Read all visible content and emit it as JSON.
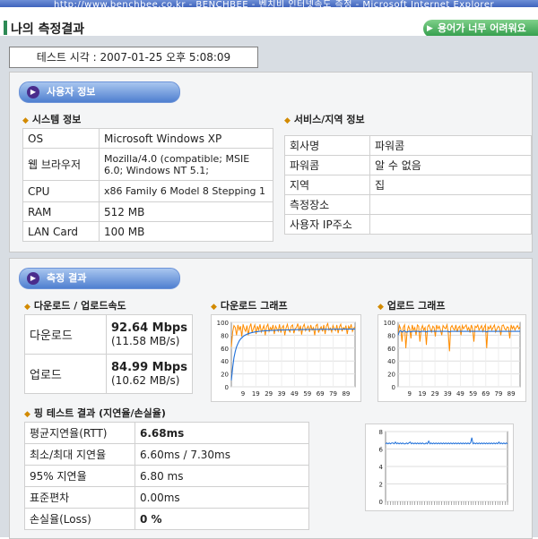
{
  "window": {
    "title": "http://www.benchbee.co.kr - BENCHBEE - 벤치비 인터넷속도 측정 - Microsoft Internet Explorer"
  },
  "header": {
    "title": "나의 측정결과",
    "help_button": "용어가 너무 어려워요"
  },
  "test_time": "테스트 시각 : 2007-01-25 오후 5:08:09",
  "user_info": {
    "title": "사용자 정보",
    "system": {
      "title": "시스템 정보",
      "rows": [
        {
          "label": "OS",
          "value": "Microsoft Windows XP"
        },
        {
          "label": "웹 브라우저",
          "value": "Mozilla/4.0 (compatible; MSIE 6.0; Windows NT 5.1;"
        },
        {
          "label": "CPU",
          "value": "x86 Family 6 Model 8 Stepping 1"
        },
        {
          "label": "RAM",
          "value": "512 MB"
        },
        {
          "label": "LAN Card",
          "value": "100 MB"
        }
      ]
    },
    "service": {
      "title": "서비스/지역 정보",
      "rows": [
        {
          "label": "회사명",
          "value": "파워콤"
        },
        {
          "label": "파워콤",
          "value": "알 수 없음"
        },
        {
          "label": "지역",
          "value": "집"
        },
        {
          "label": "측정장소",
          "value": ""
        },
        {
          "label": "사용자 IP주소",
          "value": ""
        }
      ]
    }
  },
  "results": {
    "title": "측정 결과",
    "speed": {
      "title": "다운로드 / 업로드속도",
      "download_label": "다운로드",
      "download_mbps": "92.64 Mbps",
      "download_mbs": "(11.58 MB/s)",
      "upload_label": "업로드",
      "upload_mbps": "84.99 Mbps",
      "upload_mbs": "(10.62 MB/s)"
    },
    "download_graph_title": "다운로드 그래프",
    "upload_graph_title": "업로드 그래프",
    "ping": {
      "title": "핑 테스트 결과 (지연율/손실율)",
      "rows": [
        {
          "label": "평균지연율(RTT)",
          "value": "6.68ms",
          "bold": true
        },
        {
          "label": "최소/최대 지연율",
          "value": "6.60ms / 7.30ms",
          "bold": false
        },
        {
          "label": "95% 지연율",
          "value": "6.80 ms",
          "bold": false
        },
        {
          "label": "표준편차",
          "value": "0.00ms",
          "bold": false
        },
        {
          "label": "손실율(Loss)",
          "value": "0 %",
          "bold": true
        }
      ]
    }
  },
  "colors": {
    "throughput_series": "#ff8c00",
    "average_series": "#1e6fd9",
    "pill_bg": "#6f97dd",
    "header_accent": "#2d8a55"
  },
  "chart_data": [
    {
      "type": "line",
      "title": "다운로드 그래프",
      "x_ticks": [
        9,
        19,
        29,
        39,
        49,
        59,
        69,
        79,
        89
      ],
      "y_ticks": [
        0,
        20,
        40,
        60,
        80,
        100
      ],
      "ylim": [
        0,
        100
      ],
      "xlim": [
        0,
        96
      ],
      "grid": true,
      "series": [
        {
          "color": "#ff8c00",
          "values": [
            62,
            85,
            95,
            92,
            80,
            96,
            88,
            94,
            78,
            97,
            90,
            86,
            95,
            80,
            92,
            98,
            84,
            91,
            96,
            82,
            94,
            88,
            97,
            85,
            90,
            95,
            80,
            93,
            97,
            86,
            92,
            88,
            96,
            82,
            94,
            90,
            86,
            97,
            84,
            92,
            95,
            80,
            91,
            97,
            88,
            85,
            94,
            96,
            83,
            90,
            92,
            98,
            86,
            95,
            81,
            93,
            97,
            87,
            91,
            94,
            85,
            96,
            88,
            92,
            80,
            95,
            97,
            84,
            90,
            93,
            86,
            96,
            82,
            94,
            98,
            88,
            91,
            85,
            95,
            90,
            87,
            96,
            83,
            93,
            97,
            86,
            92,
            89,
            95,
            82,
            94,
            90,
            97,
            86,
            91,
            93
          ]
        },
        {
          "color": "#1e6fd9",
          "values": [
            10,
            30,
            45,
            55,
            62,
            67,
            71,
            74,
            76,
            78,
            79.5,
            80.5,
            81.5,
            82.3,
            83,
            83.6,
            84.1,
            84.6,
            85,
            85.3,
            85.6,
            85.9,
            86.1,
            86.3,
            86.5,
            86.7,
            86.9,
            87,
            87.1,
            87.2,
            87.3,
            87.4,
            87.5,
            87.6,
            87.7,
            87.8,
            87.9,
            88,
            88,
            88.1,
            88.1,
            88.2,
            88.2,
            88.3,
            88.3,
            88.4,
            88.4,
            88.5,
            88.5,
            88.6,
            88.6,
            88.6,
            88.7,
            88.7,
            88.7,
            88.8,
            88.8,
            88.8,
            88.8,
            88.9,
            88.9,
            88.9,
            88.9,
            89,
            89,
            89,
            89,
            89,
            89.1,
            89.1,
            89.1,
            89.1,
            89.1,
            89.2,
            89.2,
            89.2,
            89.2,
            89.2,
            89.2,
            89.3,
            89.3,
            89.3,
            89.3,
            89.3,
            89.3,
            89.3,
            89.4,
            89.4,
            89.4,
            89.4,
            89.4,
            89.4,
            89.4,
            89.4,
            89.5,
            89.5
          ]
        }
      ]
    },
    {
      "type": "line",
      "title": "업로드 그래프",
      "x_ticks": [
        9,
        19,
        29,
        39,
        49,
        59,
        69,
        79,
        89
      ],
      "y_ticks": [
        0,
        20,
        40,
        60,
        80,
        100
      ],
      "ylim": [
        0,
        100
      ],
      "xlim": [
        0,
        96
      ],
      "grid": true,
      "series": [
        {
          "color": "#ff8c00",
          "values": [
            80,
            95,
            90,
            70,
            92,
            96,
            60,
            85,
            94,
            90,
            75,
            96,
            88,
            92,
            80,
            96,
            94,
            70,
            90,
            95,
            88,
            92,
            65,
            93,
            96,
            90,
            85,
            94,
            92,
            78,
            96,
            90,
            94,
            88,
            80,
            95,
            92,
            90,
            96,
            86,
            55,
            92,
            95,
            90,
            88,
            96,
            85,
            92,
            94,
            80,
            95,
            90,
            93,
            96,
            88,
            92,
            84,
            96,
            90,
            70,
            94,
            92,
            96,
            88,
            91,
            95,
            86,
            92,
            96,
            60,
            93,
            90,
            95,
            88,
            92,
            96,
            85,
            90,
            94,
            92,
            80,
            95,
            96,
            90,
            88,
            93,
            92,
            75,
            96,
            90,
            94,
            88,
            92,
            95,
            90,
            93
          ]
        },
        {
          "color": "#1e6fd9",
          "values": [
            80,
            86,
            87,
            85,
            86,
            87,
            85,
            85,
            86,
            86,
            85,
            86,
            86,
            86,
            86,
            86,
            86,
            85,
            86,
            86,
            86,
            86,
            85,
            86,
            86,
            86,
            86,
            86,
            86,
            86,
            86,
            86,
            86,
            86,
            86,
            86,
            86,
            86,
            86,
            86,
            85,
            86,
            86,
            86,
            86,
            86,
            86,
            86,
            86,
            86,
            86,
            86,
            86,
            86,
            86,
            86,
            86,
            86,
            86,
            86,
            86,
            86,
            86,
            86,
            86,
            86,
            86,
            86,
            86,
            85,
            86,
            86,
            86,
            86,
            86,
            86,
            86,
            86,
            86,
            86,
            86,
            86,
            86,
            86,
            86,
            86,
            86,
            86,
            86,
            86,
            86,
            86,
            86,
            86,
            86,
            86
          ]
        }
      ]
    },
    {
      "type": "line",
      "title": "",
      "y_ticks": [
        0,
        2,
        4,
        6,
        8
      ],
      "ylim": [
        0,
        8
      ],
      "xlim": [
        0,
        100
      ],
      "grid": true,
      "series": [
        {
          "color": "#1e6fd9",
          "values": [
            6.6,
            6.7,
            6.6,
            6.7,
            6.6,
            6.7,
            6.7,
            6.6,
            6.8,
            6.6,
            6.7,
            6.6,
            6.7,
            6.6,
            6.7,
            6.6,
            6.6,
            6.7,
            6.6,
            6.7,
            6.8,
            6.6,
            6.7,
            6.6,
            6.7,
            6.6,
            6.7,
            6.6,
            6.7,
            6.6,
            6.7,
            6.6,
            6.6,
            6.7,
            6.6,
            6.9,
            6.6,
            6.7,
            6.6,
            6.7,
            6.6,
            6.7,
            6.6,
            6.7,
            6.6,
            6.7,
            6.6,
            6.7,
            6.6,
            6.7,
            6.6,
            6.7,
            6.6,
            6.7,
            6.6,
            6.7,
            6.6,
            6.7,
            6.6,
            6.7,
            6.6,
            6.7,
            6.6,
            6.7,
            6.6,
            6.7,
            6.6,
            6.7,
            6.6,
            6.7,
            7.3,
            6.6,
            6.7,
            6.6,
            6.7,
            6.6,
            6.7,
            6.6,
            6.7,
            6.6,
            6.7,
            6.6,
            6.7,
            6.6,
            6.7,
            6.6,
            6.7,
            6.6,
            6.7,
            6.6,
            6.7,
            6.6,
            6.8,
            6.6,
            6.7,
            6.6,
            6.7,
            6.6,
            6.7,
            6.6
          ]
        }
      ]
    }
  ]
}
